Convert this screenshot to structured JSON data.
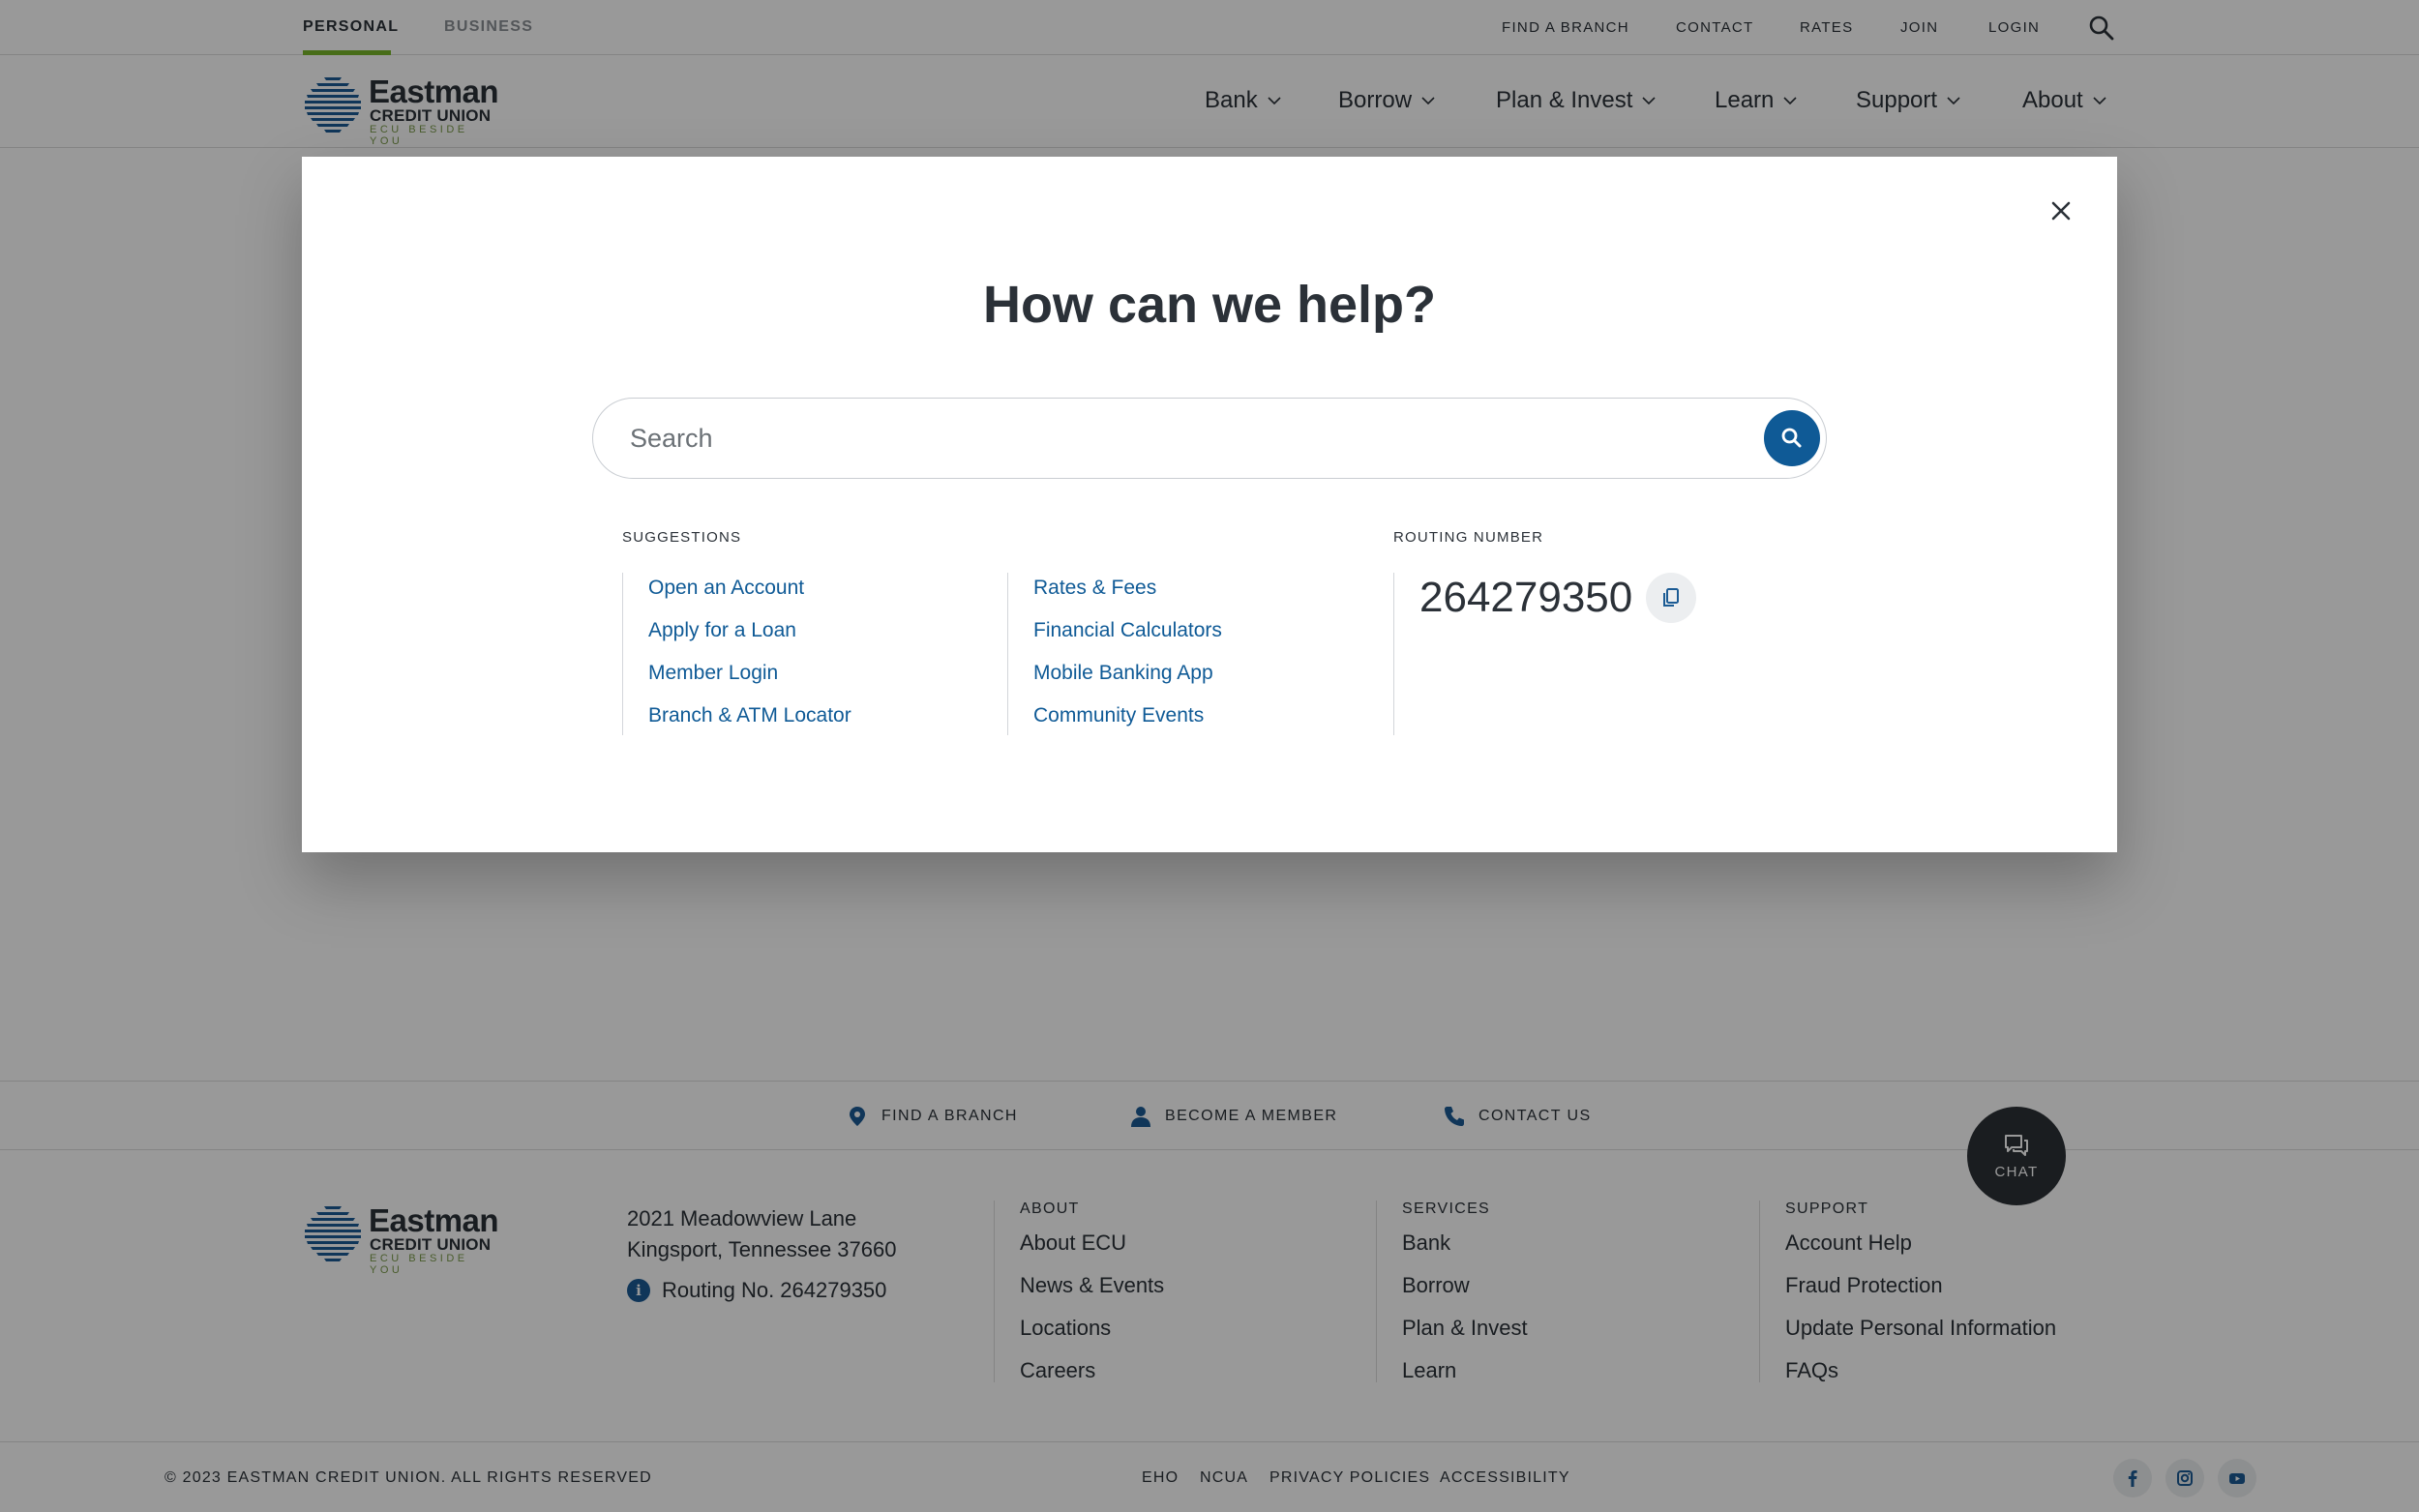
{
  "utility": {
    "tabs": [
      "PERSONAL",
      "BUSINESS"
    ],
    "links": [
      "FIND A BRANCH",
      "CONTACT",
      "RATES",
      "JOIN",
      "LOGIN"
    ]
  },
  "logo": {
    "line1": "Eastman",
    "line2": "CREDIT UNION",
    "tagline": "ECU BESIDE YOU"
  },
  "nav": {
    "items": [
      "Bank",
      "Borrow",
      "Plan & Invest",
      "Learn",
      "Support",
      "About"
    ]
  },
  "modal": {
    "title": "How can we help?",
    "search_placeholder": "Search",
    "suggestions_heading": "SUGGESTIONS",
    "suggestions_col1": [
      "Open an Account",
      "Apply for a Loan",
      "Member Login",
      "Branch & ATM Locator"
    ],
    "suggestions_col2": [
      "Rates & Fees",
      "Financial Calculators",
      "Mobile Banking App",
      "Community Events"
    ],
    "routing_heading": "ROUTING NUMBER",
    "routing_number": "264279350"
  },
  "footer_cta": {
    "find_branch": "FIND A BRANCH",
    "become_member": "BECOME A MEMBER",
    "contact_us": "CONTACT US"
  },
  "chat": {
    "label": "CHAT"
  },
  "footer": {
    "address_line1": "2021 Meadowview Lane",
    "address_line2": "Kingsport, Tennessee 37660",
    "routing_label": "Routing No. 264279350",
    "columns": [
      {
        "heading": "ABOUT",
        "links": [
          "About ECU",
          "News & Events",
          "Locations",
          "Careers"
        ]
      },
      {
        "heading": "SERVICES",
        "links": [
          "Bank",
          "Borrow",
          "Plan & Invest",
          "Learn"
        ]
      },
      {
        "heading": "SUPPORT",
        "links": [
          "Account Help",
          "Fraud Protection",
          "Update Personal Information",
          "FAQs"
        ]
      }
    ],
    "copyright": "© 2023 EASTMAN CREDIT UNION. ALL RIGHTS RESERVED",
    "legal": [
      "EHO",
      "NCUA",
      "PRIVACY POLICIES",
      "ACCESSIBILITY"
    ],
    "social_icons": [
      "facebook-icon",
      "instagram-icon",
      "youtube-icon"
    ]
  },
  "colors": {
    "brand_blue": "#0f5a96",
    "accent_green": "#78b62a",
    "text_dark": "#2b3138",
    "overlay": "rgba(0,0,0,0.40)"
  }
}
